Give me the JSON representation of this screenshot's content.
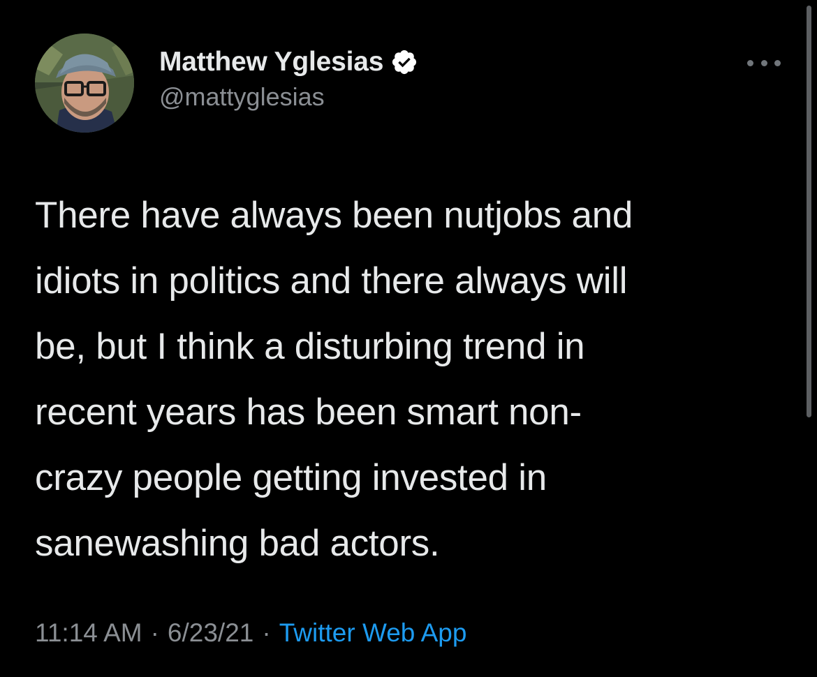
{
  "author": {
    "display_name": "Matthew Yglesias",
    "handle": "@mattyglesias",
    "avatar_icon": "user-avatar",
    "verified_icon": "verified-badge-icon"
  },
  "tweet": {
    "lines": [
      "There have always been nutjobs and",
      "idiots in politics and there always will",
      "be, but I think a disturbing trend in",
      "recent years has been smart non-",
      "crazy people getting invested in",
      "sanewashing bad actors."
    ]
  },
  "meta": {
    "time": "11:14 AM",
    "separator": "·",
    "date": "6/23/21",
    "source": "Twitter Web App"
  },
  "more_icon": "more-options-icon",
  "colors": {
    "background": "#000000",
    "text": "#e7e9ea",
    "secondary": "#8b8f94",
    "link": "#1d9bf0"
  }
}
